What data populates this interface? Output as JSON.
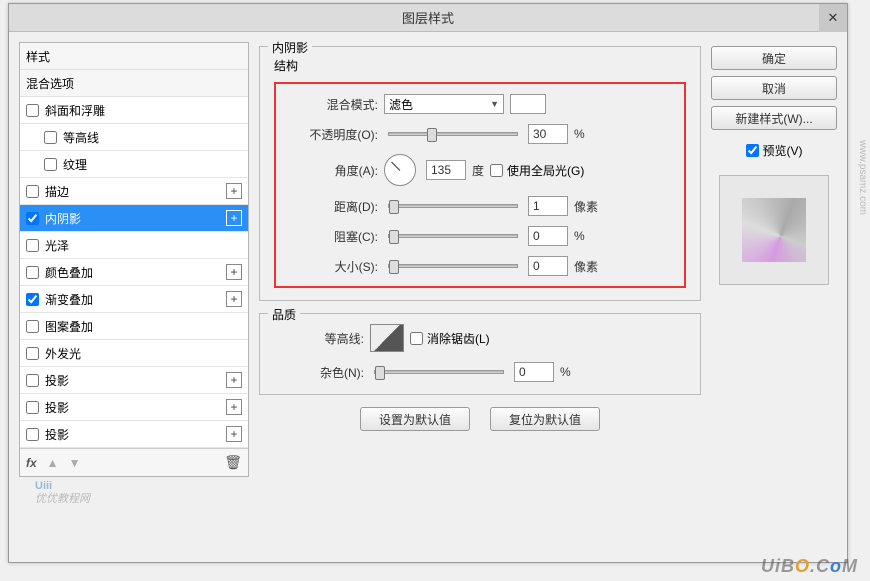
{
  "dialog": {
    "title": "图层样式"
  },
  "left": {
    "header_styles": "样式",
    "header_blend": "混合选项",
    "items": [
      {
        "label": "斜面和浮雕",
        "checked": false,
        "indent": 0,
        "hasAdd": false
      },
      {
        "label": "等高线",
        "checked": false,
        "indent": 1,
        "hasAdd": false
      },
      {
        "label": "纹理",
        "checked": false,
        "indent": 1,
        "hasAdd": false
      },
      {
        "label": "描边",
        "checked": false,
        "indent": 0,
        "hasAdd": true
      },
      {
        "label": "内阴影",
        "checked": true,
        "indent": 0,
        "hasAdd": true,
        "selected": true
      },
      {
        "label": "光泽",
        "checked": false,
        "indent": 0,
        "hasAdd": false
      },
      {
        "label": "颜色叠加",
        "checked": false,
        "indent": 0,
        "hasAdd": true
      },
      {
        "label": "渐变叠加",
        "checked": true,
        "indent": 0,
        "hasAdd": true
      },
      {
        "label": "图案叠加",
        "checked": false,
        "indent": 0,
        "hasAdd": false
      },
      {
        "label": "外发光",
        "checked": false,
        "indent": 0,
        "hasAdd": false
      },
      {
        "label": "投影",
        "checked": false,
        "indent": 0,
        "hasAdd": true
      },
      {
        "label": "投影",
        "checked": false,
        "indent": 0,
        "hasAdd": true
      },
      {
        "label": "投影",
        "checked": false,
        "indent": 0,
        "hasAdd": true
      }
    ],
    "footer_fx": "fx"
  },
  "mid": {
    "section_title": "内阴影",
    "structure_legend": "结构",
    "quality_legend": "品质",
    "blend_mode_label": "混合模式:",
    "blend_mode_value": "滤色",
    "opacity_label": "不透明度(O):",
    "opacity_value": "30",
    "opacity_unit": "%",
    "angle_label": "角度(A):",
    "angle_value": "135",
    "angle_unit": "度",
    "global_light_label": "使用全局光(G)",
    "distance_label": "距离(D):",
    "distance_value": "1",
    "distance_unit": "像素",
    "choke_label": "阻塞(C):",
    "choke_value": "0",
    "choke_unit": "%",
    "size_label": "大小(S):",
    "size_value": "0",
    "size_unit": "像素",
    "contour_label": "等高线:",
    "antialias_label": "消除锯齿(L)",
    "noise_label": "杂色(N):",
    "noise_value": "0",
    "noise_unit": "%",
    "btn_default": "设置为默认值",
    "btn_reset": "复位为默认值"
  },
  "right": {
    "ok": "确定",
    "cancel": "取消",
    "new_style": "新建样式(W)...",
    "preview_label": "预览(V)"
  },
  "watermarks": {
    "left_brand": "Uiii",
    "left_sub": "优优教程网",
    "bottom": "UiBO.CoM",
    "side": "www.psamz.com"
  }
}
